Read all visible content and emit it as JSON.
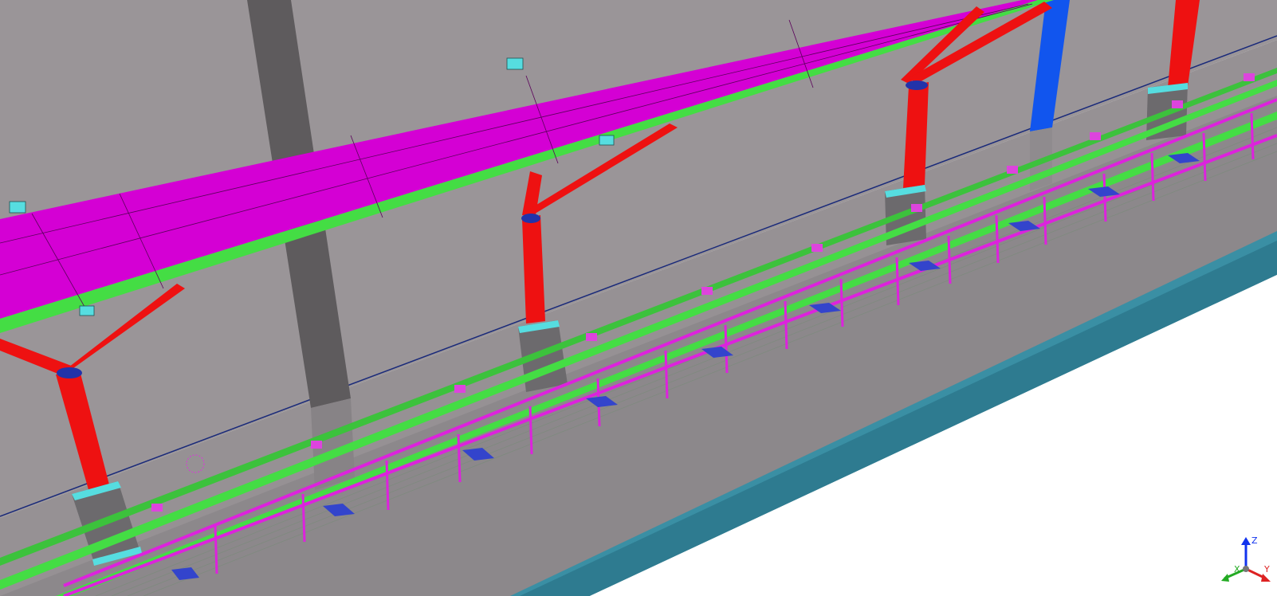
{
  "viewport": {
    "background": "#ffffff"
  },
  "colors": {
    "wall": "#9a9598",
    "wall_dark": "#8b878a",
    "floor_face": "#8e8a8d",
    "ground_band": "#2e7b90",
    "canopy_roof": "#d400d4",
    "canopy_frame": "#44dd44",
    "column": "#ee1111",
    "column_base": "#6c6a6d",
    "base_plate": "#56dde0",
    "walkway_rail": "#dd22dd",
    "walkway_frame": "#44dd44",
    "blue_post": "#1155ee",
    "dark_pillar": "#5e5b5d",
    "outline": "#1a2a7a"
  },
  "triad": {
    "axes": [
      {
        "name": "Z",
        "color": "#1133ee"
      },
      {
        "name": "X",
        "color": "#22aa22"
      },
      {
        "name": "Y",
        "color": "#dd2222"
      }
    ]
  }
}
